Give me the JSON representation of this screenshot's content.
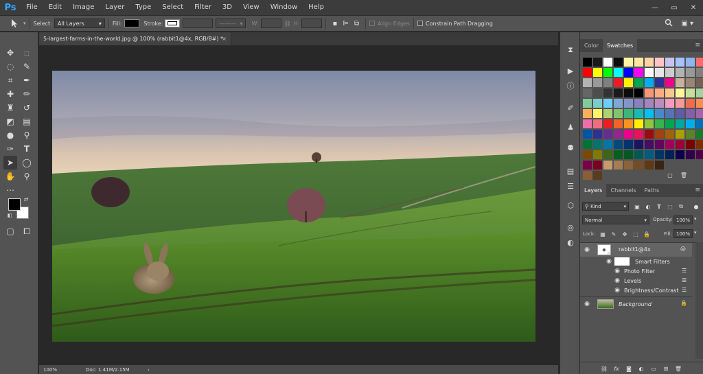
{
  "app": {
    "logo": "Ps"
  },
  "menu": [
    "File",
    "Edit",
    "Image",
    "Layer",
    "Type",
    "Select",
    "Filter",
    "3D",
    "View",
    "Window",
    "Help"
  ],
  "window_controls": {
    "minimize": "—",
    "maximize": "▭",
    "close": "✕"
  },
  "options_bar": {
    "select_label": "Select:",
    "select_value": "All Layers",
    "fill_label": "Fill:",
    "stroke_label": "Stroke:",
    "w_label": "W:",
    "h_label": "H:",
    "align_edges_label": "Align Edges",
    "constrain_label": "Constrain Path Dragging"
  },
  "document": {
    "tab_title": "5-largest-farms-in-the-world.jpg @ 100% (rabbit1@4x, RGB/8#) *",
    "tab_close": "×",
    "zoom": "100%",
    "doc_info": "Doc: 1.41M/2.15M",
    "status_arrow": "›"
  },
  "swatches_panel": {
    "tabs": [
      "Color",
      "Swatches"
    ],
    "active_tab": "Swatches",
    "menu_icon": "≡",
    "colors": [
      [
        "#000000",
        "#1a1a1a",
        "#ffffff",
        "#0d0d0d",
        "#fff5a0",
        "#ffe79f",
        "#ffd3a6",
        "#ffc4c4",
        "#c9c4ef",
        "#a7c3ff",
        "#8fb4f2",
        "#ff6b6b"
      ],
      [
        "#ff0000",
        "#ffff00",
        "#00ff00",
        "#00ffff",
        "#0000ff",
        "#ff00ff",
        "#ffffff",
        "#e6e6e6",
        "#cccccc",
        "#b3b3b3",
        "#999999",
        "#808080"
      ],
      [
        "#b3b3b3",
        "#999999",
        "#808080",
        "#ed1c24",
        "#fff200",
        "#00a651",
        "#00aeef",
        "#2e3192",
        "#ec008c",
        "#c7b299",
        "#998675",
        "#736357"
      ],
      [
        "#666666",
        "#4d4d4d",
        "#333333",
        "#1a1a1a",
        "#0d0d0d",
        "#000000",
        "#f7977a",
        "#fbad82",
        "#fdc68c",
        "#fff799",
        "#c6df9c",
        "#a4d49d"
      ],
      [
        "#81ca9d",
        "#7bcdc9",
        "#6ccff7",
        "#7ea7d8",
        "#8493ca",
        "#8882be",
        "#a286bd",
        "#bc8cbf",
        "#f49bc1",
        "#f5999d",
        "#f16c4d",
        "#f68e54"
      ],
      [
        "#fbaf5a",
        "#fff467",
        "#acd372",
        "#7dc473",
        "#39b778",
        "#16bcb4",
        "#00bff3",
        "#438ccb",
        "#5573b7",
        "#5e5ca7",
        "#855fa8",
        "#a763a9"
      ],
      [
        "#ef6ea8",
        "#f16d7e",
        "#ee1d24",
        "#f16522",
        "#f7941d",
        "#fff100",
        "#8fc63d",
        "#37b44a",
        "#00a650",
        "#00a99e",
        "#00aeef",
        "#0072bc"
      ],
      [
        "#0054a5",
        "#2f3192",
        "#652c91",
        "#91278f",
        "#ed008c",
        "#ee105a",
        "#9d0a0f",
        "#a1410d",
        "#a36209",
        "#aba000",
        "#588528",
        "#197b30"
      ],
      [
        "#007236",
        "#00746a",
        "#0076a4",
        "#004a80",
        "#003370",
        "#1d1363",
        "#450e61",
        "#62055f",
        "#9e005c",
        "#9d0039",
        "#790000",
        "#7b3000"
      ],
      [
        "#7c4900",
        "#827a00",
        "#3e6617",
        "#045f20",
        "#005824",
        "#005951",
        "#005b7e",
        "#003562",
        "#002056",
        "#0c004b",
        "#30004a",
        "#4b0048"
      ],
      [
        "#7a0045",
        "#7a0026",
        "#c69c6d",
        "#a67c52",
        "#8c6239",
        "#754c24",
        "#603913",
        "#3c2415"
      ],
      [
        "#8a5f37",
        "#5c3b1c"
      ]
    ]
  },
  "layers_panel": {
    "tabs": [
      "Layers",
      "Channels",
      "Paths"
    ],
    "active_tab": "Layers",
    "menu_icon": "≡",
    "filter_label": "Kind",
    "blend_mode": "Normal",
    "opacity_label": "Opacity:",
    "opacity_value": "100%",
    "lock_label": "Lock:",
    "fill_label": "Fill:",
    "fill_value": "100%",
    "layers": [
      {
        "name": "rabbit1@4x",
        "type": "smart-object"
      },
      {
        "name": "Smart Filters",
        "type": "smart-filters"
      },
      {
        "name": "Photo Filter",
        "type": "filter"
      },
      {
        "name": "Levels",
        "type": "filter"
      },
      {
        "name": "Brightness/Contrast",
        "type": "filter"
      },
      {
        "name": "Background",
        "type": "background"
      }
    ]
  }
}
